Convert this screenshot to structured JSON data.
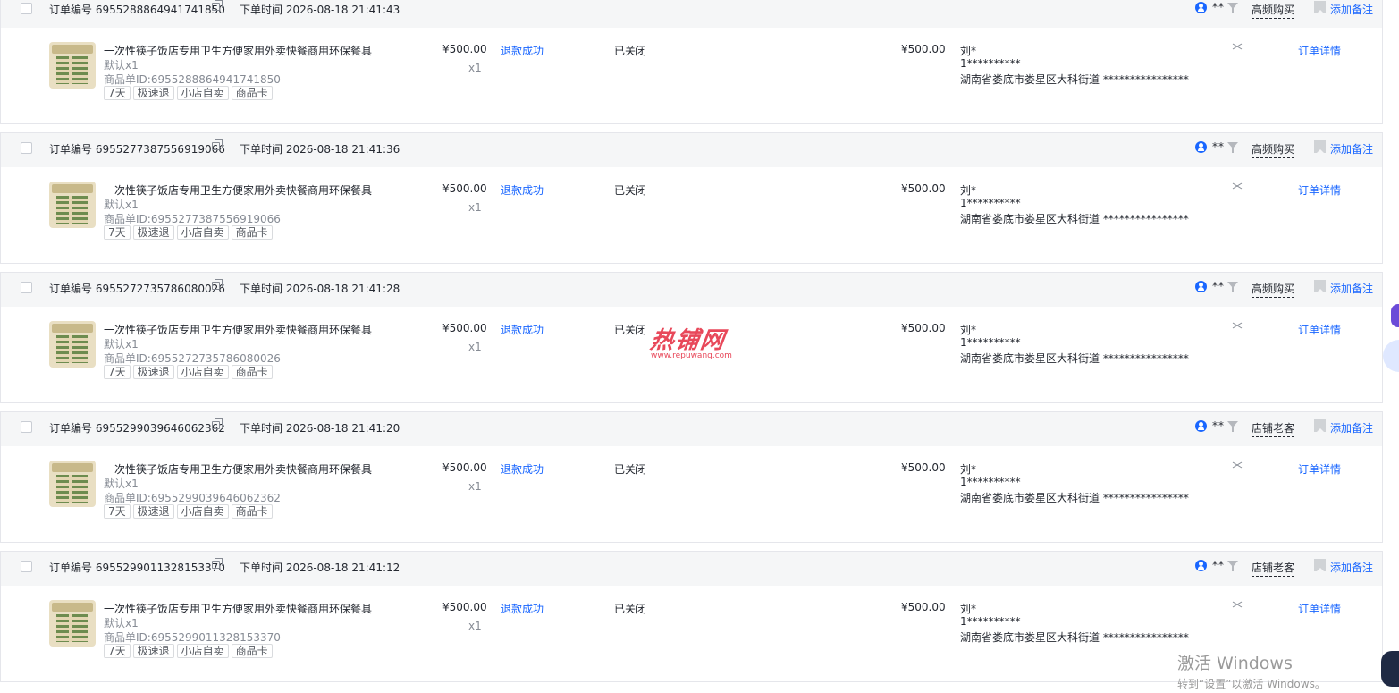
{
  "labels": {
    "order_no_prefix": "订单编号",
    "order_time_prefix": "下单时间",
    "buyer_mask": "**",
    "add_note": "添加备注",
    "product_id_prefix": "商品单ID:",
    "order_detail": "订单详情"
  },
  "orders": [
    {
      "order_no_line": "订单编号 6955288864941741850",
      "order_time_line": "下单时间 2026-08-18 21:41:43",
      "buyer_tag": "高频购买",
      "product_title": "一次性筷子饭店专用卫生方便家用外卖快餐商用环保餐具",
      "spec": "默认x1",
      "product_id_line": "商品单ID:6955288864941741850",
      "tags": [
        "7天",
        "极速退",
        "小店自卖",
        "商品卡"
      ],
      "price": "¥500.00",
      "qty": "x1",
      "refund_status": "退款成功",
      "order_status": "已关闭",
      "paid_amount": "¥500.00",
      "receiver_name": "刘*",
      "receiver_phone": "1**********",
      "receiver_address": "湖南省娄底市娄星区大科街道 ****************",
      "detail_link": "订单详情",
      "add_note": "添加备注",
      "buyer_mask": "**"
    },
    {
      "order_no_line": "订单编号 6955277387556919066",
      "order_time_line": "下单时间 2026-08-18 21:41:36",
      "buyer_tag": "高频购买",
      "product_title": "一次性筷子饭店专用卫生方便家用外卖快餐商用环保餐具",
      "spec": "默认x1",
      "product_id_line": "商品单ID:6955277387556919066",
      "tags": [
        "7天",
        "极速退",
        "小店自卖",
        "商品卡"
      ],
      "price": "¥500.00",
      "qty": "x1",
      "refund_status": "退款成功",
      "order_status": "已关闭",
      "paid_amount": "¥500.00",
      "receiver_name": "刘*",
      "receiver_phone": "1**********",
      "receiver_address": "湖南省娄底市娄星区大科街道 ****************",
      "detail_link": "订单详情",
      "add_note": "添加备注",
      "buyer_mask": "**"
    },
    {
      "order_no_line": "订单编号 6955272735786080026",
      "order_time_line": "下单时间 2026-08-18 21:41:28",
      "buyer_tag": "高频购买",
      "product_title": "一次性筷子饭店专用卫生方便家用外卖快餐商用环保餐具",
      "spec": "默认x1",
      "product_id_line": "商品单ID:6955272735786080026",
      "tags": [
        "7天",
        "极速退",
        "小店自卖",
        "商品卡"
      ],
      "price": "¥500.00",
      "qty": "x1",
      "refund_status": "退款成功",
      "order_status": "已关闭",
      "paid_amount": "¥500.00",
      "receiver_name": "刘*",
      "receiver_phone": "1**********",
      "receiver_address": "湖南省娄底市娄星区大科街道 ****************",
      "detail_link": "订单详情",
      "add_note": "添加备注",
      "buyer_mask": "**"
    },
    {
      "order_no_line": "订单编号 6955299039646062362",
      "order_time_line": "下单时间 2026-08-18 21:41:20",
      "buyer_tag": "店铺老客",
      "product_title": "一次性筷子饭店专用卫生方便家用外卖快餐商用环保餐具",
      "spec": "默认x1",
      "product_id_line": "商品单ID:6955299039646062362",
      "tags": [
        "7天",
        "极速退",
        "小店自卖",
        "商品卡"
      ],
      "price": "¥500.00",
      "qty": "x1",
      "refund_status": "退款成功",
      "order_status": "已关闭",
      "paid_amount": "¥500.00",
      "receiver_name": "刘*",
      "receiver_phone": "1**********",
      "receiver_address": "湖南省娄底市娄星区大科街道 ****************",
      "detail_link": "订单详情",
      "add_note": "添加备注",
      "buyer_mask": "**"
    },
    {
      "order_no_line": "订单编号 6955299011328153370",
      "order_time_line": "下单时间 2026-08-18 21:41:12",
      "buyer_tag": "店铺老客",
      "product_title": "一次性筷子饭店专用卫生方便家用外卖快餐商用环保餐具",
      "spec": "默认x1",
      "product_id_line": "商品单ID:6955299011328153370",
      "tags": [
        "7天",
        "极速退",
        "小店自卖",
        "商品卡"
      ],
      "price": "¥500.00",
      "qty": "x1",
      "refund_status": "退款成功",
      "order_status": "已关闭",
      "paid_amount": "¥500.00",
      "receiver_name": "刘*",
      "receiver_phone": "1**********",
      "receiver_address": "湖南省娄底市娄星区大科街道 ****************",
      "detail_link": "订单详情",
      "add_note": "添加备注",
      "buyer_mask": "**"
    }
  ],
  "watermark": {
    "main": "热铺网",
    "sub": "www.repuwang.com"
  },
  "windows_activation": {
    "title": "激活 Windows",
    "subtitle": "转到“设置”以激活 Windows。"
  },
  "colors": {
    "accent": "#1966ff",
    "header_bg": "#f5f6f7",
    "border": "#e5e6eb",
    "text": "#252931",
    "muted": "#868b94"
  },
  "icons": [
    "checkbox",
    "copy-icon",
    "buyer-icon",
    "filter-icon",
    "flag-icon",
    "collapse-icon"
  ]
}
